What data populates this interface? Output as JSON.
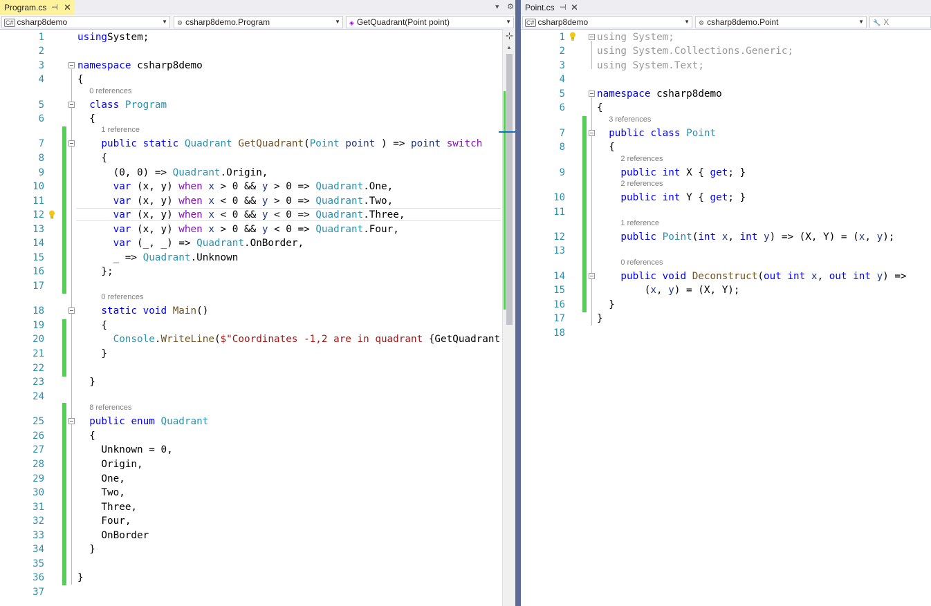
{
  "left": {
    "tab": {
      "title": "Program.cs",
      "pin": "⊣",
      "close": "✕"
    },
    "nav": {
      "project": "csharp8demo",
      "class": "csharp8demo.Program",
      "member": "GetQuadrant(Point point)"
    },
    "lines": [
      {
        "n": "1",
        "t": [
          [
            "kw",
            "using"
          ],
          [
            "",
            "System;"
          ]
        ]
      },
      {
        "n": "2",
        "t": []
      },
      {
        "n": "3",
        "t": [
          [
            "kw",
            "namespace"
          ],
          [
            "",
            " csharp8demo"
          ]
        ]
      },
      {
        "n": "4",
        "t": [
          [
            "",
            "{"
          ]
        ]
      },
      {
        "n": "5",
        "t": [
          [
            "kw",
            "class"
          ],
          [
            "",
            " "
          ],
          [
            "ty",
            "Program"
          ]
        ]
      },
      {
        "n": "6",
        "t": [
          [
            "",
            "{"
          ]
        ]
      },
      {
        "n": "7",
        "t": [
          [
            "kw",
            "public static"
          ],
          [
            "",
            " "
          ],
          [
            "ty",
            "Quadrant"
          ],
          [
            "",
            " "
          ],
          [
            "mt",
            "GetQuadrant"
          ],
          [
            "",
            "("
          ],
          [
            "ty",
            "Point"
          ],
          [
            "",
            " "
          ],
          [
            "vr",
            "point"
          ],
          [
            "",
            " ) => "
          ],
          [
            "vr",
            "point"
          ],
          [
            "",
            " "
          ],
          [
            "ctl",
            "switch"
          ]
        ]
      },
      {
        "n": "8",
        "t": [
          [
            "",
            "{"
          ]
        ]
      },
      {
        "n": "9",
        "t": [
          [
            "",
            "(0, 0) => "
          ],
          [
            "ty",
            "Quadrant"
          ],
          [
            "",
            ".Origin,"
          ]
        ]
      },
      {
        "n": "10",
        "t": [
          [
            "kw",
            "var"
          ],
          [
            "",
            " (x, y) "
          ],
          [
            "ctl",
            "when"
          ],
          [
            "",
            " "
          ],
          [
            "vr",
            "x"
          ],
          [
            "",
            " > 0 && "
          ],
          [
            "vr",
            "y"
          ],
          [
            "",
            " > 0 => "
          ],
          [
            "ty",
            "Quadrant"
          ],
          [
            "",
            ".One,"
          ]
        ]
      },
      {
        "n": "11",
        "t": [
          [
            "kw",
            "var"
          ],
          [
            "",
            " (x, y) "
          ],
          [
            "ctl",
            "when"
          ],
          [
            "",
            " "
          ],
          [
            "vr",
            "x"
          ],
          [
            "",
            " < 0 && "
          ],
          [
            "vr",
            "y"
          ],
          [
            "",
            " > 0 => "
          ],
          [
            "ty",
            "Quadrant"
          ],
          [
            "",
            ".Two,"
          ]
        ]
      },
      {
        "n": "12",
        "t": [
          [
            "kw",
            "var"
          ],
          [
            "",
            " (x, y) "
          ],
          [
            "ctl",
            "when"
          ],
          [
            "",
            " "
          ],
          [
            "vr",
            "x"
          ],
          [
            "",
            " < 0 && "
          ],
          [
            "vr",
            "y"
          ],
          [
            "",
            " < 0 => "
          ],
          [
            "ty",
            "Quadrant"
          ],
          [
            "",
            ".Three,"
          ]
        ]
      },
      {
        "n": "13",
        "t": [
          [
            "kw",
            "var"
          ],
          [
            "",
            " (x, y) "
          ],
          [
            "ctl",
            "when"
          ],
          [
            "",
            " "
          ],
          [
            "vr",
            "x"
          ],
          [
            "",
            " > 0 && "
          ],
          [
            "vr",
            "y"
          ],
          [
            "",
            " < 0 => "
          ],
          [
            "ty",
            "Quadrant"
          ],
          [
            "",
            ".Four,"
          ]
        ]
      },
      {
        "n": "14",
        "t": [
          [
            "kw",
            "var"
          ],
          [
            "",
            " (_, _) => "
          ],
          [
            "ty",
            "Quadrant"
          ],
          [
            "",
            ".OnBorder,"
          ]
        ]
      },
      {
        "n": "15",
        "t": [
          [
            "",
            "_ => "
          ],
          [
            "ty",
            "Quadrant"
          ],
          [
            "",
            ".Unknown"
          ]
        ]
      },
      {
        "n": "16",
        "t": [
          [
            "",
            "};"
          ]
        ]
      },
      {
        "n": "17",
        "t": []
      },
      {
        "n": "18",
        "t": [
          [
            "kw",
            "static void"
          ],
          [
            "",
            " "
          ],
          [
            "mt",
            "Main"
          ],
          [
            "",
            "()"
          ]
        ]
      },
      {
        "n": "19",
        "t": [
          [
            "",
            "{"
          ]
        ]
      },
      {
        "n": "20",
        "t": [
          [
            "ty",
            "Console"
          ],
          [
            "",
            "."
          ],
          [
            "mt",
            "WriteLine"
          ],
          [
            "",
            "("
          ],
          [
            "st",
            "$\"Coordinates -1,2 are in quadrant "
          ],
          [
            "",
            "{GetQuadrant"
          ]
        ]
      },
      {
        "n": "21",
        "t": [
          [
            "",
            "}"
          ]
        ]
      },
      {
        "n": "22",
        "t": []
      },
      {
        "n": "23",
        "t": [
          [
            "",
            "}"
          ]
        ]
      },
      {
        "n": "24",
        "t": []
      },
      {
        "n": "25",
        "t": [
          [
            "kw",
            "public enum"
          ],
          [
            "",
            " "
          ],
          [
            "ty",
            "Quadrant"
          ]
        ]
      },
      {
        "n": "26",
        "t": [
          [
            "",
            "{"
          ]
        ]
      },
      {
        "n": "27",
        "t": [
          [
            "",
            "Unknown = 0,"
          ]
        ]
      },
      {
        "n": "28",
        "t": [
          [
            "",
            "Origin,"
          ]
        ]
      },
      {
        "n": "29",
        "t": [
          [
            "",
            "One,"
          ]
        ]
      },
      {
        "n": "30",
        "t": [
          [
            "",
            "Two,"
          ]
        ]
      },
      {
        "n": "31",
        "t": [
          [
            "",
            "Three,"
          ]
        ]
      },
      {
        "n": "32",
        "t": [
          [
            "",
            "Four,"
          ]
        ]
      },
      {
        "n": "33",
        "t": [
          [
            "",
            "OnBorder"
          ]
        ]
      },
      {
        "n": "34",
        "t": [
          [
            "",
            "}"
          ]
        ]
      },
      {
        "n": "35",
        "t": []
      },
      {
        "n": "36",
        "t": [
          [
            "",
            "}"
          ]
        ]
      },
      {
        "n": "37",
        "t": []
      }
    ],
    "lens": {
      "5": "0 references",
      "7": "1 reference",
      "18": "0 references",
      "25": "8 references"
    }
  },
  "right": {
    "tab": {
      "title": "Point.cs",
      "pin": "⊣",
      "close": "✕"
    },
    "nav": {
      "project": "csharp8demo",
      "class": "csharp8demo.Point",
      "member": "X"
    },
    "lines": [
      {
        "n": "1",
        "t": [
          [
            "gr",
            "using System;"
          ]
        ]
      },
      {
        "n": "2",
        "t": [
          [
            "gr",
            "using System.Collections.Generic;"
          ]
        ]
      },
      {
        "n": "3",
        "t": [
          [
            "gr",
            "using System.Text;"
          ]
        ]
      },
      {
        "n": "4",
        "t": []
      },
      {
        "n": "5",
        "t": [
          [
            "kw",
            "namespace"
          ],
          [
            "",
            " csharp8demo"
          ]
        ]
      },
      {
        "n": "6",
        "t": [
          [
            "",
            "{"
          ]
        ]
      },
      {
        "n": "7",
        "t": [
          [
            "kw",
            "public class"
          ],
          [
            "",
            " "
          ],
          [
            "ty",
            "Point"
          ]
        ]
      },
      {
        "n": "8",
        "t": [
          [
            "",
            "{"
          ]
        ]
      },
      {
        "n": "9",
        "t": [
          [
            "kw",
            "public int"
          ],
          [
            "",
            " X { "
          ],
          [
            "kw",
            "get"
          ],
          [
            "",
            "; }"
          ]
        ]
      },
      {
        "n": "10",
        "t": [
          [
            "kw",
            "public int"
          ],
          [
            "",
            " Y { "
          ],
          [
            "kw",
            "get"
          ],
          [
            "",
            "; }"
          ]
        ]
      },
      {
        "n": "11",
        "t": []
      },
      {
        "n": "12",
        "t": [
          [
            "kw",
            "public"
          ],
          [
            "",
            " "
          ],
          [
            "ty",
            "Point"
          ],
          [
            "",
            "("
          ],
          [
            "kw",
            "int"
          ],
          [
            "",
            " "
          ],
          [
            "vr",
            "x"
          ],
          [
            "",
            ", "
          ],
          [
            "kw",
            "int"
          ],
          [
            "",
            " "
          ],
          [
            "vr",
            "y"
          ],
          [
            "",
            ") => (X, Y) = ("
          ],
          [
            "vr",
            "x"
          ],
          [
            "",
            ", "
          ],
          [
            "vr",
            "y"
          ],
          [
            "",
            ");"
          ]
        ]
      },
      {
        "n": "13",
        "t": []
      },
      {
        "n": "14",
        "t": [
          [
            "kw",
            "public void"
          ],
          [
            "",
            " "
          ],
          [
            "mt",
            "Deconstruct"
          ],
          [
            "",
            "("
          ],
          [
            "kw",
            "out int"
          ],
          [
            "",
            " "
          ],
          [
            "vr",
            "x"
          ],
          [
            "",
            ", "
          ],
          [
            "kw",
            "out int"
          ],
          [
            "",
            " "
          ],
          [
            "vr",
            "y"
          ],
          [
            "",
            ") =>"
          ]
        ]
      },
      {
        "n": "15",
        "t": [
          [
            "",
            "("
          ],
          [
            "vr",
            "x"
          ],
          [
            "",
            ", "
          ],
          [
            "vr",
            "y"
          ],
          [
            "",
            ") = (X, Y);"
          ]
        ]
      },
      {
        "n": "16",
        "t": [
          [
            "",
            "}"
          ]
        ]
      },
      {
        "n": "17",
        "t": [
          [
            "",
            "}"
          ]
        ]
      },
      {
        "n": "18",
        "t": []
      }
    ],
    "lens": {
      "7": "3 references",
      "9": "2 references",
      "10": "2 references",
      "12": "1 reference",
      "14": "0 references"
    }
  }
}
